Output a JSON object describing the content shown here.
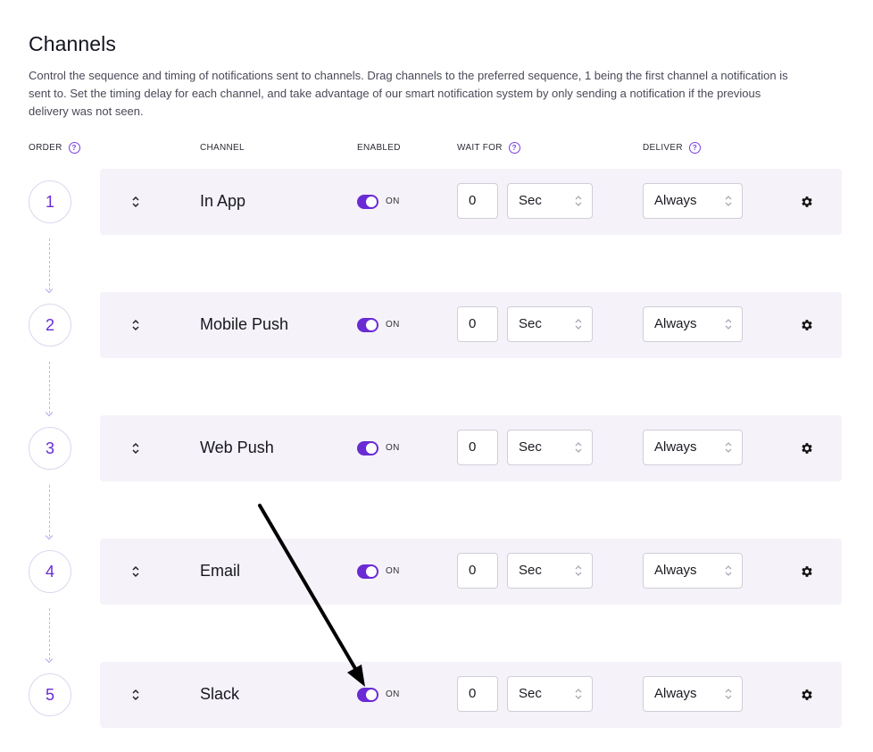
{
  "page": {
    "title": "Channels",
    "description": "Control the sequence and timing of notifications sent to channels. Drag channels to the preferred sequence, 1 being the first channel a notification is sent to. Set the timing delay for each channel, and take advantage of our smart notification system by only sending a notification if the previous delivery was not seen."
  },
  "columns": {
    "order": "ORDER",
    "channel": "CHANNEL",
    "enabled": "ENABLED",
    "wait_for": "WAIT FOR",
    "deliver": "DELIVER",
    "help_glyph": "?"
  },
  "channels": [
    {
      "order": "1",
      "name": "In App",
      "enabled": true,
      "enabled_label": "ON",
      "wait_value": "0",
      "wait_unit": "Sec",
      "deliver": "Always"
    },
    {
      "order": "2",
      "name": "Mobile Push",
      "enabled": true,
      "enabled_label": "ON",
      "wait_value": "0",
      "wait_unit": "Sec",
      "deliver": "Always"
    },
    {
      "order": "3",
      "name": "Web Push",
      "enabled": true,
      "enabled_label": "ON",
      "wait_value": "0",
      "wait_unit": "Sec",
      "deliver": "Always"
    },
    {
      "order": "4",
      "name": "Email",
      "enabled": true,
      "enabled_label": "ON",
      "wait_value": "0",
      "wait_unit": "Sec",
      "deliver": "Always"
    },
    {
      "order": "5",
      "name": "Slack",
      "enabled": true,
      "enabled_label": "ON",
      "wait_value": "0",
      "wait_unit": "Sec",
      "deliver": "Always"
    }
  ],
  "icons": {
    "help": "question-circle-icon",
    "drag": "drag-handle-icon",
    "caret": "select-caret-icon",
    "settings": "gear-icon",
    "annotation": "arrow-annotation"
  },
  "colors": {
    "accent": "#6a2bd4",
    "row_background": "#f5f2f9"
  }
}
